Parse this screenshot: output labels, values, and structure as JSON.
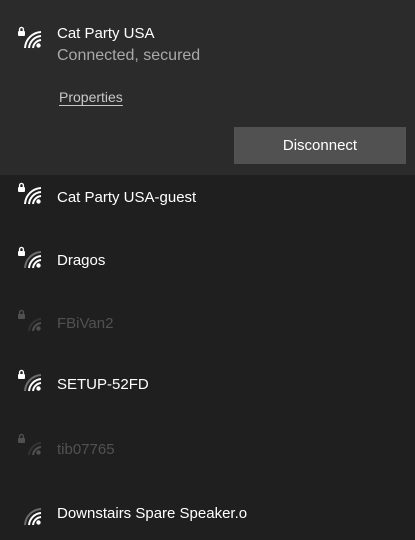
{
  "connected": {
    "name": "Cat Party USA",
    "status": "Connected, secured",
    "properties_label": "Properties",
    "disconnect_label": "Disconnect",
    "icon": "wifi-secured-icon"
  },
  "networks": [
    {
      "name": "Cat Party USA-guest",
      "icon": "wifi-secured-icon",
      "signal": "full",
      "secured": true
    },
    {
      "name": "Dragos",
      "icon": "wifi-secured-icon",
      "signal": "medium",
      "secured": true
    },
    {
      "name": "FBiVan2",
      "icon": "wifi-secured-icon",
      "signal": "weak",
      "secured": true
    },
    {
      "name": "SETUP-52FD",
      "icon": "wifi-secured-icon",
      "signal": "medium",
      "secured": true
    },
    {
      "name": "tib07765",
      "icon": "wifi-secured-icon",
      "signal": "weak",
      "secured": true
    },
    {
      "name": "Downstairs Spare Speaker.o",
      "icon": "wifi-open-icon",
      "signal": "medium",
      "secured": false
    }
  ],
  "colors": {
    "background": "#1f1f1f",
    "connected_background": "#2b2b2b",
    "button_background": "#515151",
    "secondary_text": "#a9a9a9"
  }
}
